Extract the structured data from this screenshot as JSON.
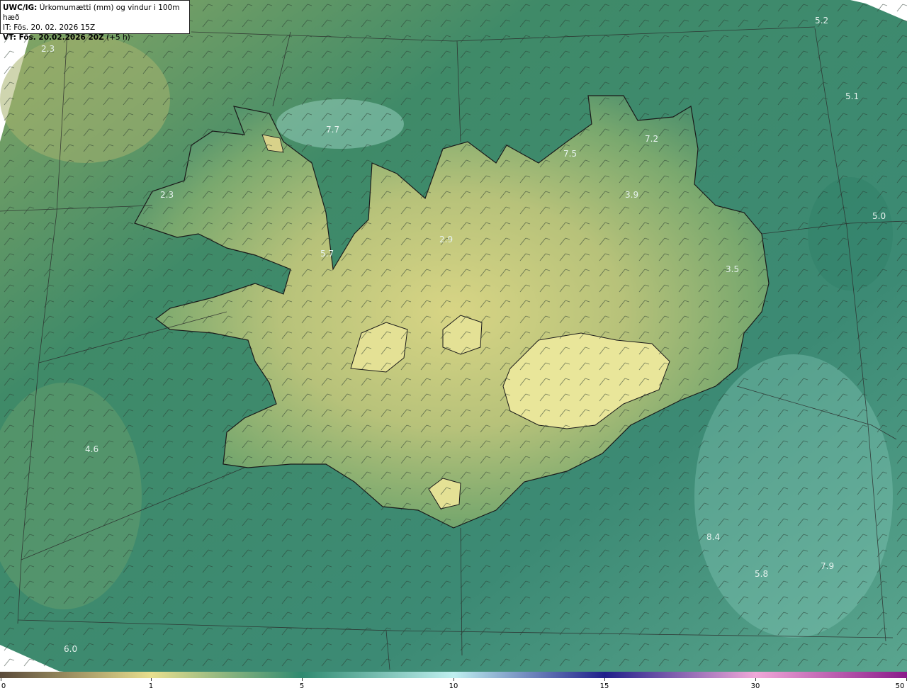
{
  "header": {
    "line1_bold": "UWC/IG:",
    "line1_rest": "Úrkomumætti (mm) og vindur i 100m hæð",
    "line2": "IT: Fös. 20. 02. 2026 15Z",
    "line3_bold": "VT: Fös. 20.02.2026 20Z",
    "line3_rest": "(+5 h)"
  },
  "map_values": [
    {
      "id": "v52",
      "text": "5.2"
    },
    {
      "id": "v23a",
      "text": "2.3"
    },
    {
      "id": "v51",
      "text": "5.1"
    },
    {
      "id": "v77",
      "text": "7.7"
    },
    {
      "id": "v72",
      "text": "7.2"
    },
    {
      "id": "v75",
      "text": "7.5"
    },
    {
      "id": "v39",
      "text": "3.9"
    },
    {
      "id": "v23b",
      "text": "2.3"
    },
    {
      "id": "v50",
      "text": "5.0"
    },
    {
      "id": "v29",
      "text": "2.9"
    },
    {
      "id": "v57",
      "text": "5.7"
    },
    {
      "id": "v35",
      "text": "3.5"
    },
    {
      "id": "v46",
      "text": "4.6"
    },
    {
      "id": "v84",
      "text": "8.4"
    },
    {
      "id": "v79",
      "text": "7.9"
    },
    {
      "id": "v58",
      "text": "5.8"
    },
    {
      "id": "v60",
      "text": "6.0"
    }
  ],
  "colorbar": {
    "ticks": [
      "0",
      "1",
      "5",
      "10",
      "15",
      "30",
      "50"
    ],
    "colors": [
      "#5a4a3a",
      "#e8df8e",
      "#2f8a70",
      "#bff0f0",
      "#20208a",
      "#f0a8d8",
      "#8a1a8a"
    ]
  }
}
